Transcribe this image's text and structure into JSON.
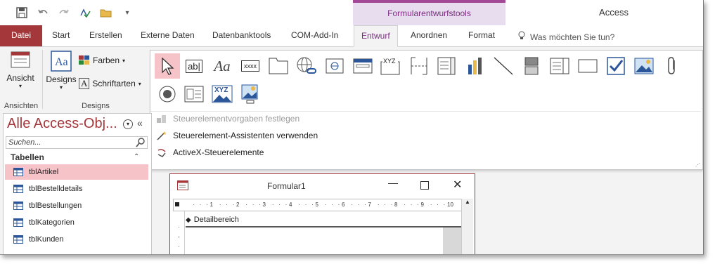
{
  "app": {
    "title": "Access",
    "context_group": "Formularentwurfstools"
  },
  "qat": {
    "save": "save-icon",
    "undo": "undo-icon",
    "redo": "redo-icon",
    "check": "spellcheck-icon",
    "folder": "folder-icon",
    "more": "▾"
  },
  "tabs": [
    {
      "label": "Datei"
    },
    {
      "label": "Start"
    },
    {
      "label": "Erstellen"
    },
    {
      "label": "Externe Daten"
    },
    {
      "label": "Datenbanktools"
    },
    {
      "label": "COM-Add-In"
    },
    {
      "label": "Entwurf"
    },
    {
      "label": "Anordnen"
    },
    {
      "label": "Format"
    }
  ],
  "tellme": "Was möchten Sie tun?",
  "ribbon": {
    "ansicht": {
      "label": "Ansicht",
      "group": "Ansichten"
    },
    "designs": {
      "label": "Designs",
      "farben": "Farben",
      "schriftarten": "Schriftarten",
      "group": "Designs"
    }
  },
  "gallery": {
    "menu": [
      {
        "label": "Steuerelementvorgaben festlegen",
        "enabled": false
      },
      {
        "label": "Steuerelement-Assistenten verwenden",
        "enabled": true
      },
      {
        "label": "ActiveX-Steuerelemente",
        "enabled": true
      }
    ],
    "textbox_text": "ab|",
    "label_text": "Aa",
    "xxxx_text": "xxxx",
    "xyz_text": "XYZ"
  },
  "nav": {
    "title": "Alle Access-Obj...",
    "search_placeholder": "Suchen...",
    "section": "Tabellen",
    "items": [
      {
        "label": "tblArtikel",
        "selected": true
      },
      {
        "label": "tblBestelldetails"
      },
      {
        "label": "tblBestellungen"
      },
      {
        "label": "tblKategorien"
      },
      {
        "label": "tblKunden"
      }
    ]
  },
  "form": {
    "title": "Formular1",
    "section": "Detailbereich",
    "ruler": [
      "1",
      "2",
      "3",
      "4",
      "5",
      "6",
      "7",
      "8",
      "9",
      "10"
    ]
  },
  "colors": {
    "accent": "#a4373a",
    "context": "#7b2c80",
    "selected": "#f6c3c8"
  }
}
